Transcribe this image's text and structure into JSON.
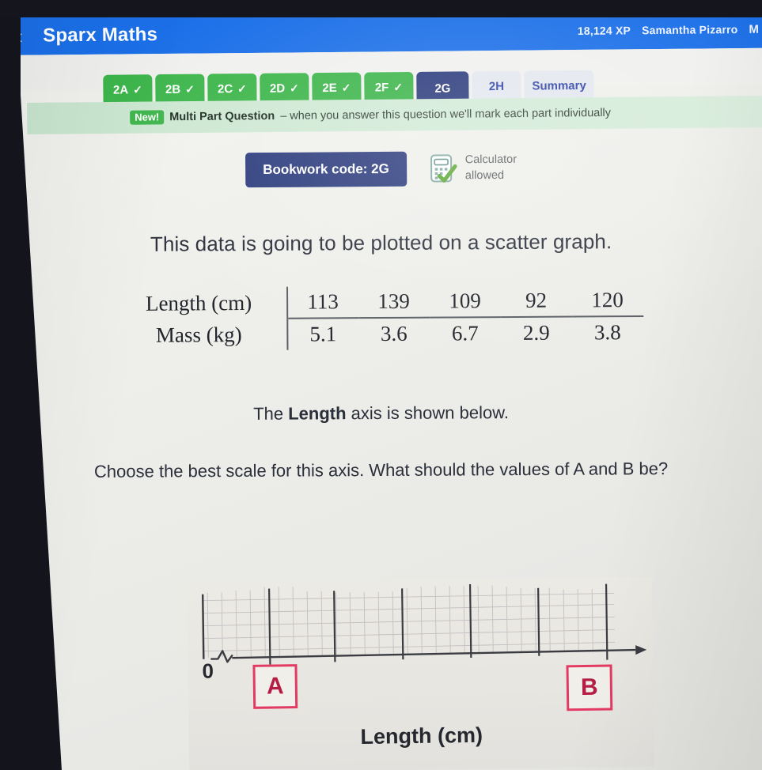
{
  "header": {
    "back_icon": "chevron-left-icon",
    "brand": "Sparx Maths",
    "xp": "18,124 XP",
    "user": "Samantha Pizarro",
    "more": "M"
  },
  "tabs": [
    {
      "label": "2A",
      "state": "done",
      "tick": "✓"
    },
    {
      "label": "2B",
      "state": "done",
      "tick": "✓"
    },
    {
      "label": "2C",
      "state": "done",
      "tick": "✓"
    },
    {
      "label": "2D",
      "state": "done",
      "tick": "✓"
    },
    {
      "label": "2E",
      "state": "done",
      "tick": "✓"
    },
    {
      "label": "2F",
      "state": "done",
      "tick": "✓"
    },
    {
      "label": "2G",
      "state": "active",
      "tick": ""
    },
    {
      "label": "2H",
      "state": "plain",
      "tick": ""
    },
    {
      "label": "Summary",
      "state": "plain",
      "tick": ""
    }
  ],
  "banner": {
    "badge": "New!",
    "strong": "Multi Part Question",
    "text": "– when you answer this question we'll mark each part individually"
  },
  "bookwork": {
    "code_label": "Bookwork code: 2G",
    "calculator_icon": "calculator-allowed-icon",
    "calculator_line1": "Calculator",
    "calculator_line2": "allowed"
  },
  "question": {
    "intro": "This data is going to be plotted on a scatter graph.",
    "line2_prefix": "The ",
    "line2_bold": "Length",
    "line2_suffix": " axis is shown below.",
    "line3": "Choose the best scale for this axis. What should the values of A and B be?"
  },
  "table": {
    "row_headers": [
      "Length (cm)",
      "Mass (kg)"
    ],
    "rows": [
      [
        "113",
        "139",
        "109",
        "92",
        "120"
      ],
      [
        "5.1",
        "3.6",
        "6.7",
        "2.9",
        "3.8"
      ]
    ]
  },
  "figure": {
    "zero_label": "0",
    "axis_title": "Length (cm)",
    "answer_box_a": "A",
    "answer_box_b": "B"
  },
  "colors": {
    "header_blue": "#1b6fe8",
    "tab_green": "#3cb54a",
    "tab_navy": "#2a3a7c",
    "answer_red": "#e33a63",
    "banner_green": "#cfe9d4"
  },
  "chart_data": {
    "type": "scatter",
    "title": "Length axis scale question",
    "xlabel": "Length (cm)",
    "ylabel": "",
    "axis_break": true,
    "zero_label": "0",
    "major_tick_count": 6,
    "unlabeled_ticks": [
      "A",
      "",
      "",
      "",
      "",
      "B"
    ],
    "grid": true,
    "categories": [
      "Length (cm)",
      "Mass (kg)"
    ],
    "series": [
      {
        "name": "Length (cm)",
        "values": [
          113,
          139,
          109,
          92,
          120
        ]
      },
      {
        "name": "Mass (kg)",
        "values": [
          5.1,
          3.6,
          6.7,
          2.9,
          3.8
        ]
      }
    ],
    "points": [
      {
        "length": 113,
        "mass": 5.1
      },
      {
        "length": 139,
        "mass": 3.6
      },
      {
        "length": 109,
        "mass": 6.7
      },
      {
        "length": 92,
        "mass": 2.9
      },
      {
        "length": 120,
        "mass": 3.8
      }
    ]
  }
}
